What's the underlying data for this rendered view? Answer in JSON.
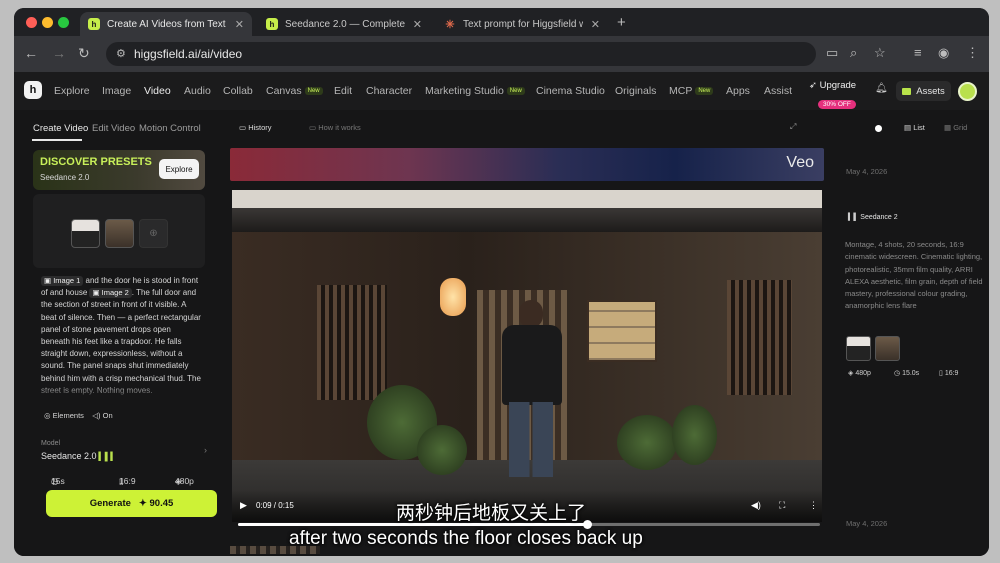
{
  "browser": {
    "tabs": [
      {
        "title": "Create AI Videos from Text &",
        "favicon": "higgsfield-favicon",
        "active": true
      },
      {
        "title": "Seedance 2.0 — Complete Pl",
        "favicon": "higgsfield-favicon",
        "active": false
      },
      {
        "title": "Text prompt for Higgsfield w",
        "favicon": "asterisk-favicon",
        "active": false
      }
    ],
    "url": "higgsfield.ai/ai/video"
  },
  "nav": {
    "items": [
      "Explore",
      "Image",
      "Video",
      "Audio",
      "Collab",
      "Canvas",
      "Edit",
      "Character",
      "Marketing Studio",
      "Cinema Studio",
      "Originals",
      "MCP",
      "Apps",
      "Assist"
    ],
    "new_badge": "New",
    "upgrade": "Upgrade",
    "discount": "30% OFF",
    "assets": "Assets",
    "accent_color": "#cdf236"
  },
  "left_panel": {
    "tabs": [
      "Create Video",
      "Edit Video",
      "Motion Control"
    ],
    "presets": {
      "title": "DISCOVER PRESETS",
      "subtitle": "Seedance 2.0",
      "button": "Explore"
    },
    "prompt": {
      "chip1": "Image 1",
      "text1": " and the door he is stood in front of and house ",
      "chip2": "Image 2",
      "text2": ". The full door and the section of street in front of it visible. A beat of silence. Then — a perfect rectangular panel of stone pavement drops open beneath his feet like a trapdoor. He falls straight down, expressionless, without a sound. The panel snaps shut immediately behind him with a crisp mechanical thud. The street is empty. Nothing moves."
    },
    "elements_label": "Elements",
    "audio_label": "On",
    "model_label": "Model",
    "model_value": "Seedance 2.0",
    "duration": "15s",
    "aspect": "16:9",
    "resolution": "480p",
    "generate_label": "Generate",
    "generate_cost": "90.45"
  },
  "center": {
    "history_label": "History",
    "how_label": "How it works",
    "banner_text": "Veo",
    "video": {
      "current_time": "0:09",
      "duration": "0:15",
      "progress_fraction": 0.6
    },
    "subtitle_zh": "两秒钟后地板又关上了",
    "subtitle_en": "after two seconds the floor closes back up"
  },
  "right_panel": {
    "list_label": "List",
    "grid_label": "Grid",
    "date1": "May 4, 2026",
    "model": "Seedance 2",
    "description": "Montage, 4 shots, 20 seconds, 16:9 cinematic widescreen. Cinematic lighting, photorealistic, 35mm film quality, ARRI ALEXA aesthetic, film grain, depth of field mastery, professional colour grading, anamorphic lens flare",
    "meta_resolution": "480p",
    "meta_duration": "15.0s",
    "meta_aspect": "16:9",
    "date2": "May 4, 2026"
  }
}
